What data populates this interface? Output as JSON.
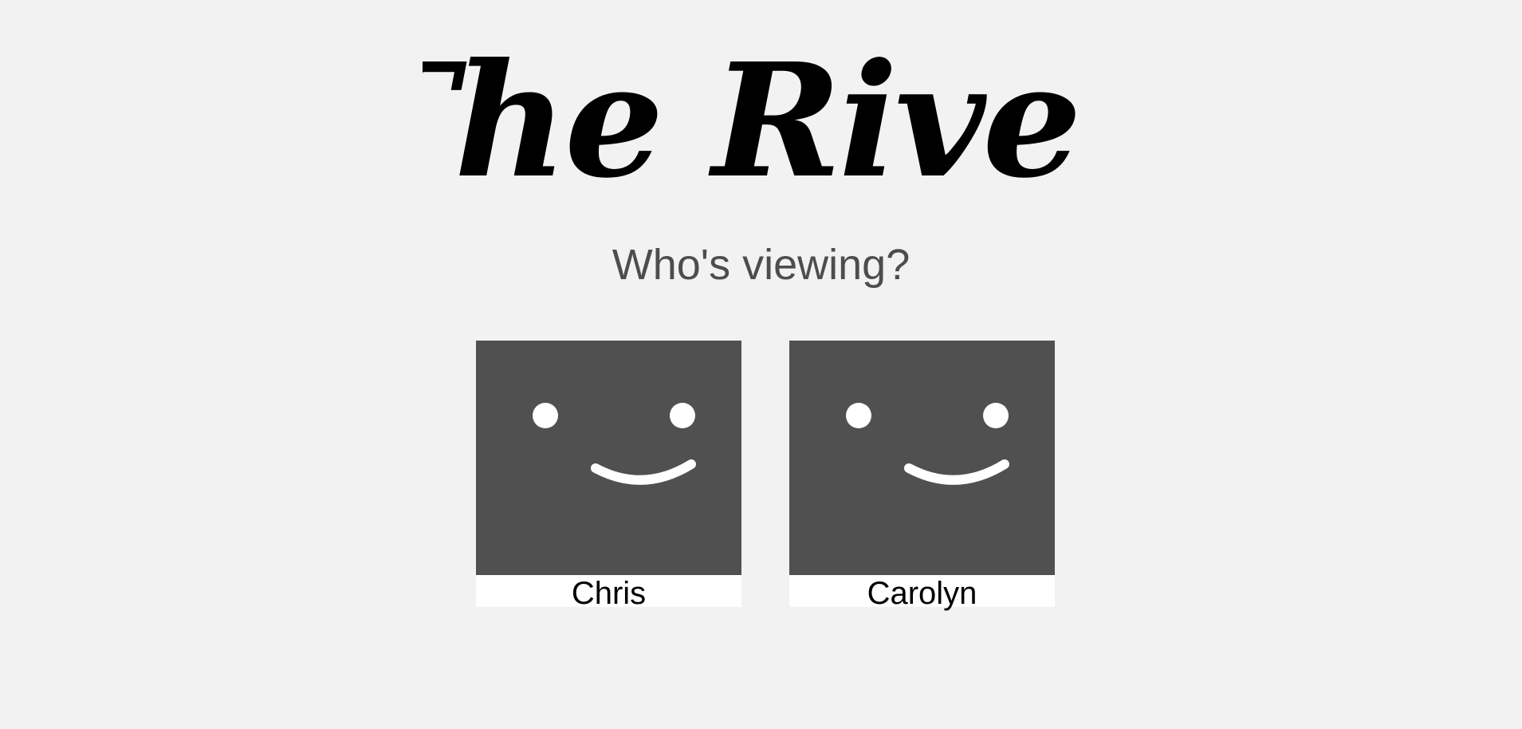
{
  "app": {
    "logo_text": "The River"
  },
  "main": {
    "title": "Who's viewing?",
    "profiles": [
      {
        "name": "Chris",
        "icon": "smiley-face-icon"
      },
      {
        "name": "Carolyn",
        "icon": "smiley-face-icon"
      }
    ]
  },
  "colors": {
    "background": "#f2f2f2",
    "avatar_bg": "#505050",
    "avatar_face": "#ffffff",
    "name_bar_bg": "#ffffff",
    "title_text": "#4d4d4d"
  }
}
